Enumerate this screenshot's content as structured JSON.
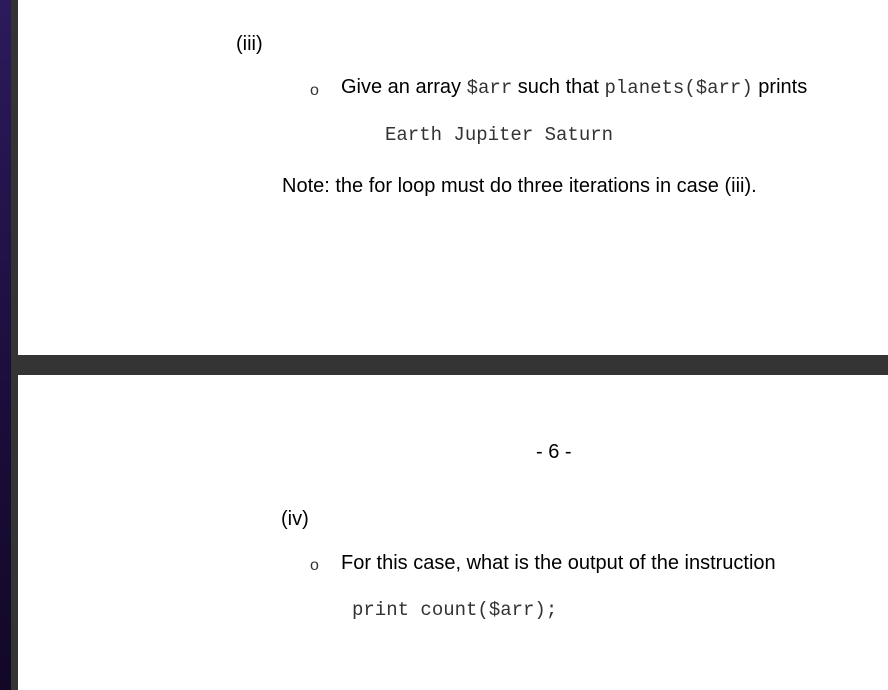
{
  "page1": {
    "section_label": "(iii)",
    "bullet_symbol": "o",
    "question": {
      "part1": "Give an array ",
      "code1": "$arr",
      "part2": " such that ",
      "code2": "planets($arr)",
      "part3": " prints"
    },
    "expected_output": "Earth Jupiter Saturn",
    "note": "Note: the for loop must do three iterations in case (iii)."
  },
  "page2": {
    "page_number": "- 6 -",
    "section_label": "(iv)",
    "bullet_symbol": "o",
    "question": "For this case, what is the output of the instruction",
    "code": "print count($arr);"
  }
}
